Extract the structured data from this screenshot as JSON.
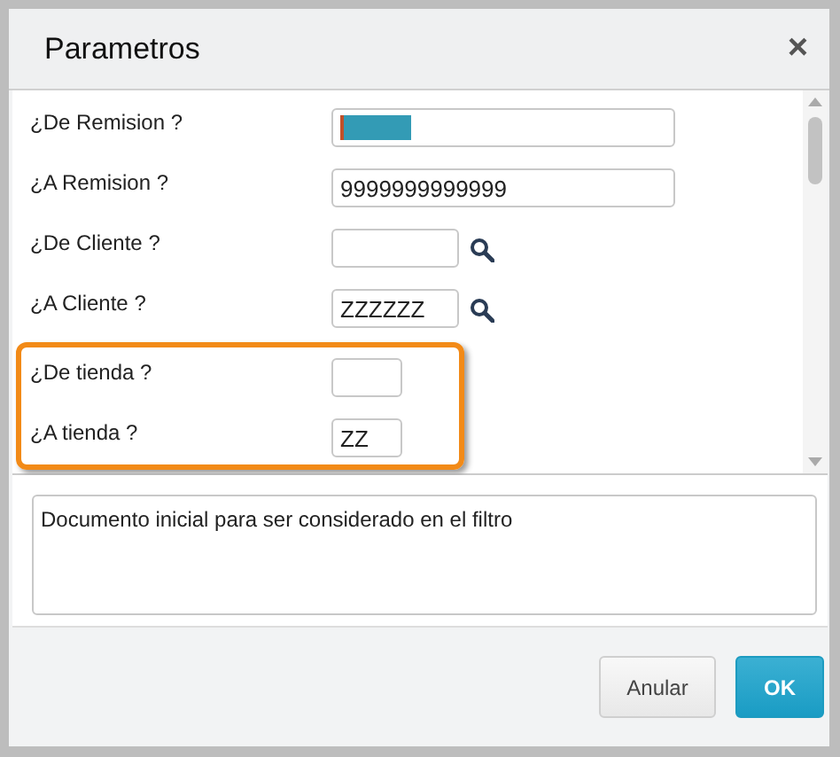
{
  "dialog": {
    "title": "Parametros",
    "close": "×"
  },
  "fields": [
    {
      "label": "¿De Remision ?",
      "kind": "wide",
      "text_selected": true,
      "highlighted": false
    },
    {
      "label": "¿A Remision ?",
      "kind": "wide",
      "value": "9999999999999",
      "text_selected": false,
      "highlighted": false
    },
    {
      "label": "¿De Cliente ?",
      "kind": "lookup",
      "text_selected": false,
      "highlighted": false
    },
    {
      "label": "¿A Cliente ?",
      "kind": "lookup",
      "value": "ZZZZZZ",
      "text_selected": false,
      "highlighted": false
    },
    {
      "label": "¿De tienda ?",
      "kind": "narrow",
      "text_selected": false,
      "highlighted": true
    },
    {
      "label": "¿A tienda ?",
      "kind": "narrow",
      "value": "ZZ",
      "text_selected": false,
      "highlighted": true
    }
  ],
  "help": "Documento inicial para ser considerado en el filtro",
  "buttons": [
    {
      "label": "Anular",
      "kind": "secondary"
    },
    {
      "label": "OK",
      "kind": "primary"
    }
  ]
}
